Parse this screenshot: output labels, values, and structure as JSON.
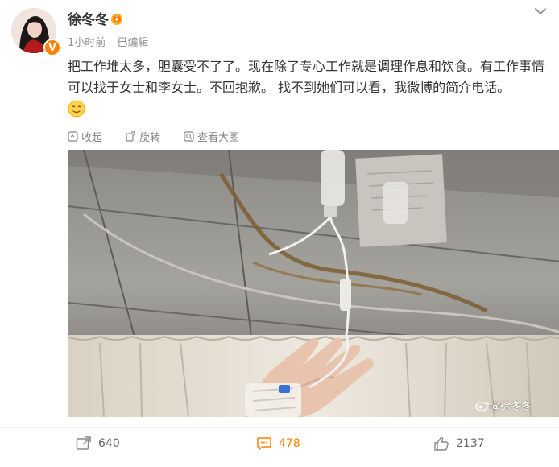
{
  "user": {
    "name": "徐冬冬",
    "avatar_alt": "avatar"
  },
  "meta": {
    "time": "1小时前",
    "edited": "已编辑"
  },
  "post": {
    "text": "把工作堆太多，胆囊受不了了。现在除了专心工作就是调理作息和饮食。有工作事情可以找于女士和李女士。不回抱歉。 找不到她们可以看，我微博的简介电话。"
  },
  "toolbar": {
    "collapse": "收起",
    "rotate": "旋转",
    "view_large": "查看大图"
  },
  "watermark": {
    "text": "@徐冬冬"
  },
  "actions": {
    "reposts": "640",
    "comments": "478",
    "likes": "2137"
  },
  "colors": {
    "accent": "#ff8200",
    "text": "#333333",
    "muted": "#939393"
  }
}
